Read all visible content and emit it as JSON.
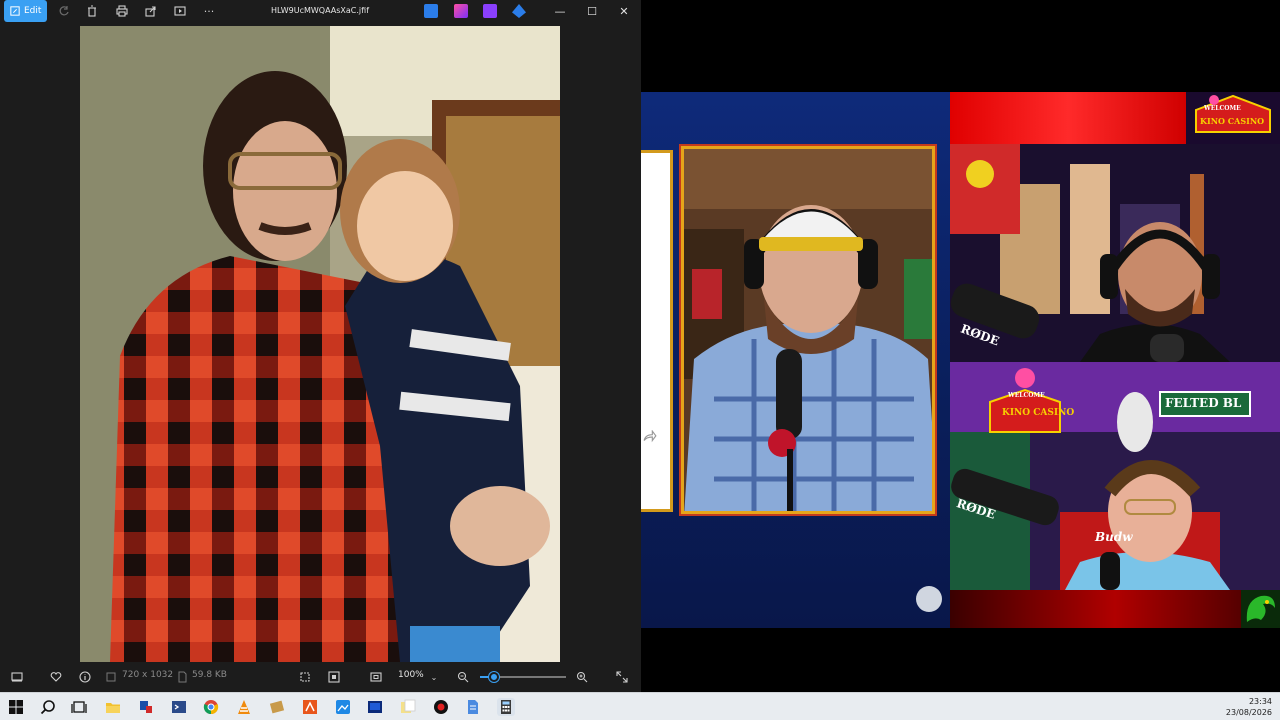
{
  "viewer": {
    "edit_label": "Edit",
    "file_name": "HLW9UcMWQAAsXaC.jfif",
    "more_label": "···",
    "window_controls": {
      "minimize": "—",
      "maximize": "☐",
      "close": "✕"
    },
    "status": {
      "dimensions": "720 x 1032",
      "file_size": "59.8 KB",
      "zoom": "100%",
      "zoom_level_fraction": 0.16
    }
  },
  "stream": {
    "casino_logo": {
      "line1": "WELCOME",
      "line2": "KINO CASINO"
    },
    "street_sign": "FELTED BL",
    "mic_brand": "RØDE",
    "beer_brand": "Budw"
  },
  "taskbar": {
    "time": "23:34",
    "date": "23/08/2026"
  },
  "colors": {
    "accent": "#3aa0f3",
    "viewer_bg": "#1c1c1c",
    "stream_blue": "#0e2a7a",
    "casino_red": "#e00000",
    "frame_gold": "#e5a51a"
  }
}
